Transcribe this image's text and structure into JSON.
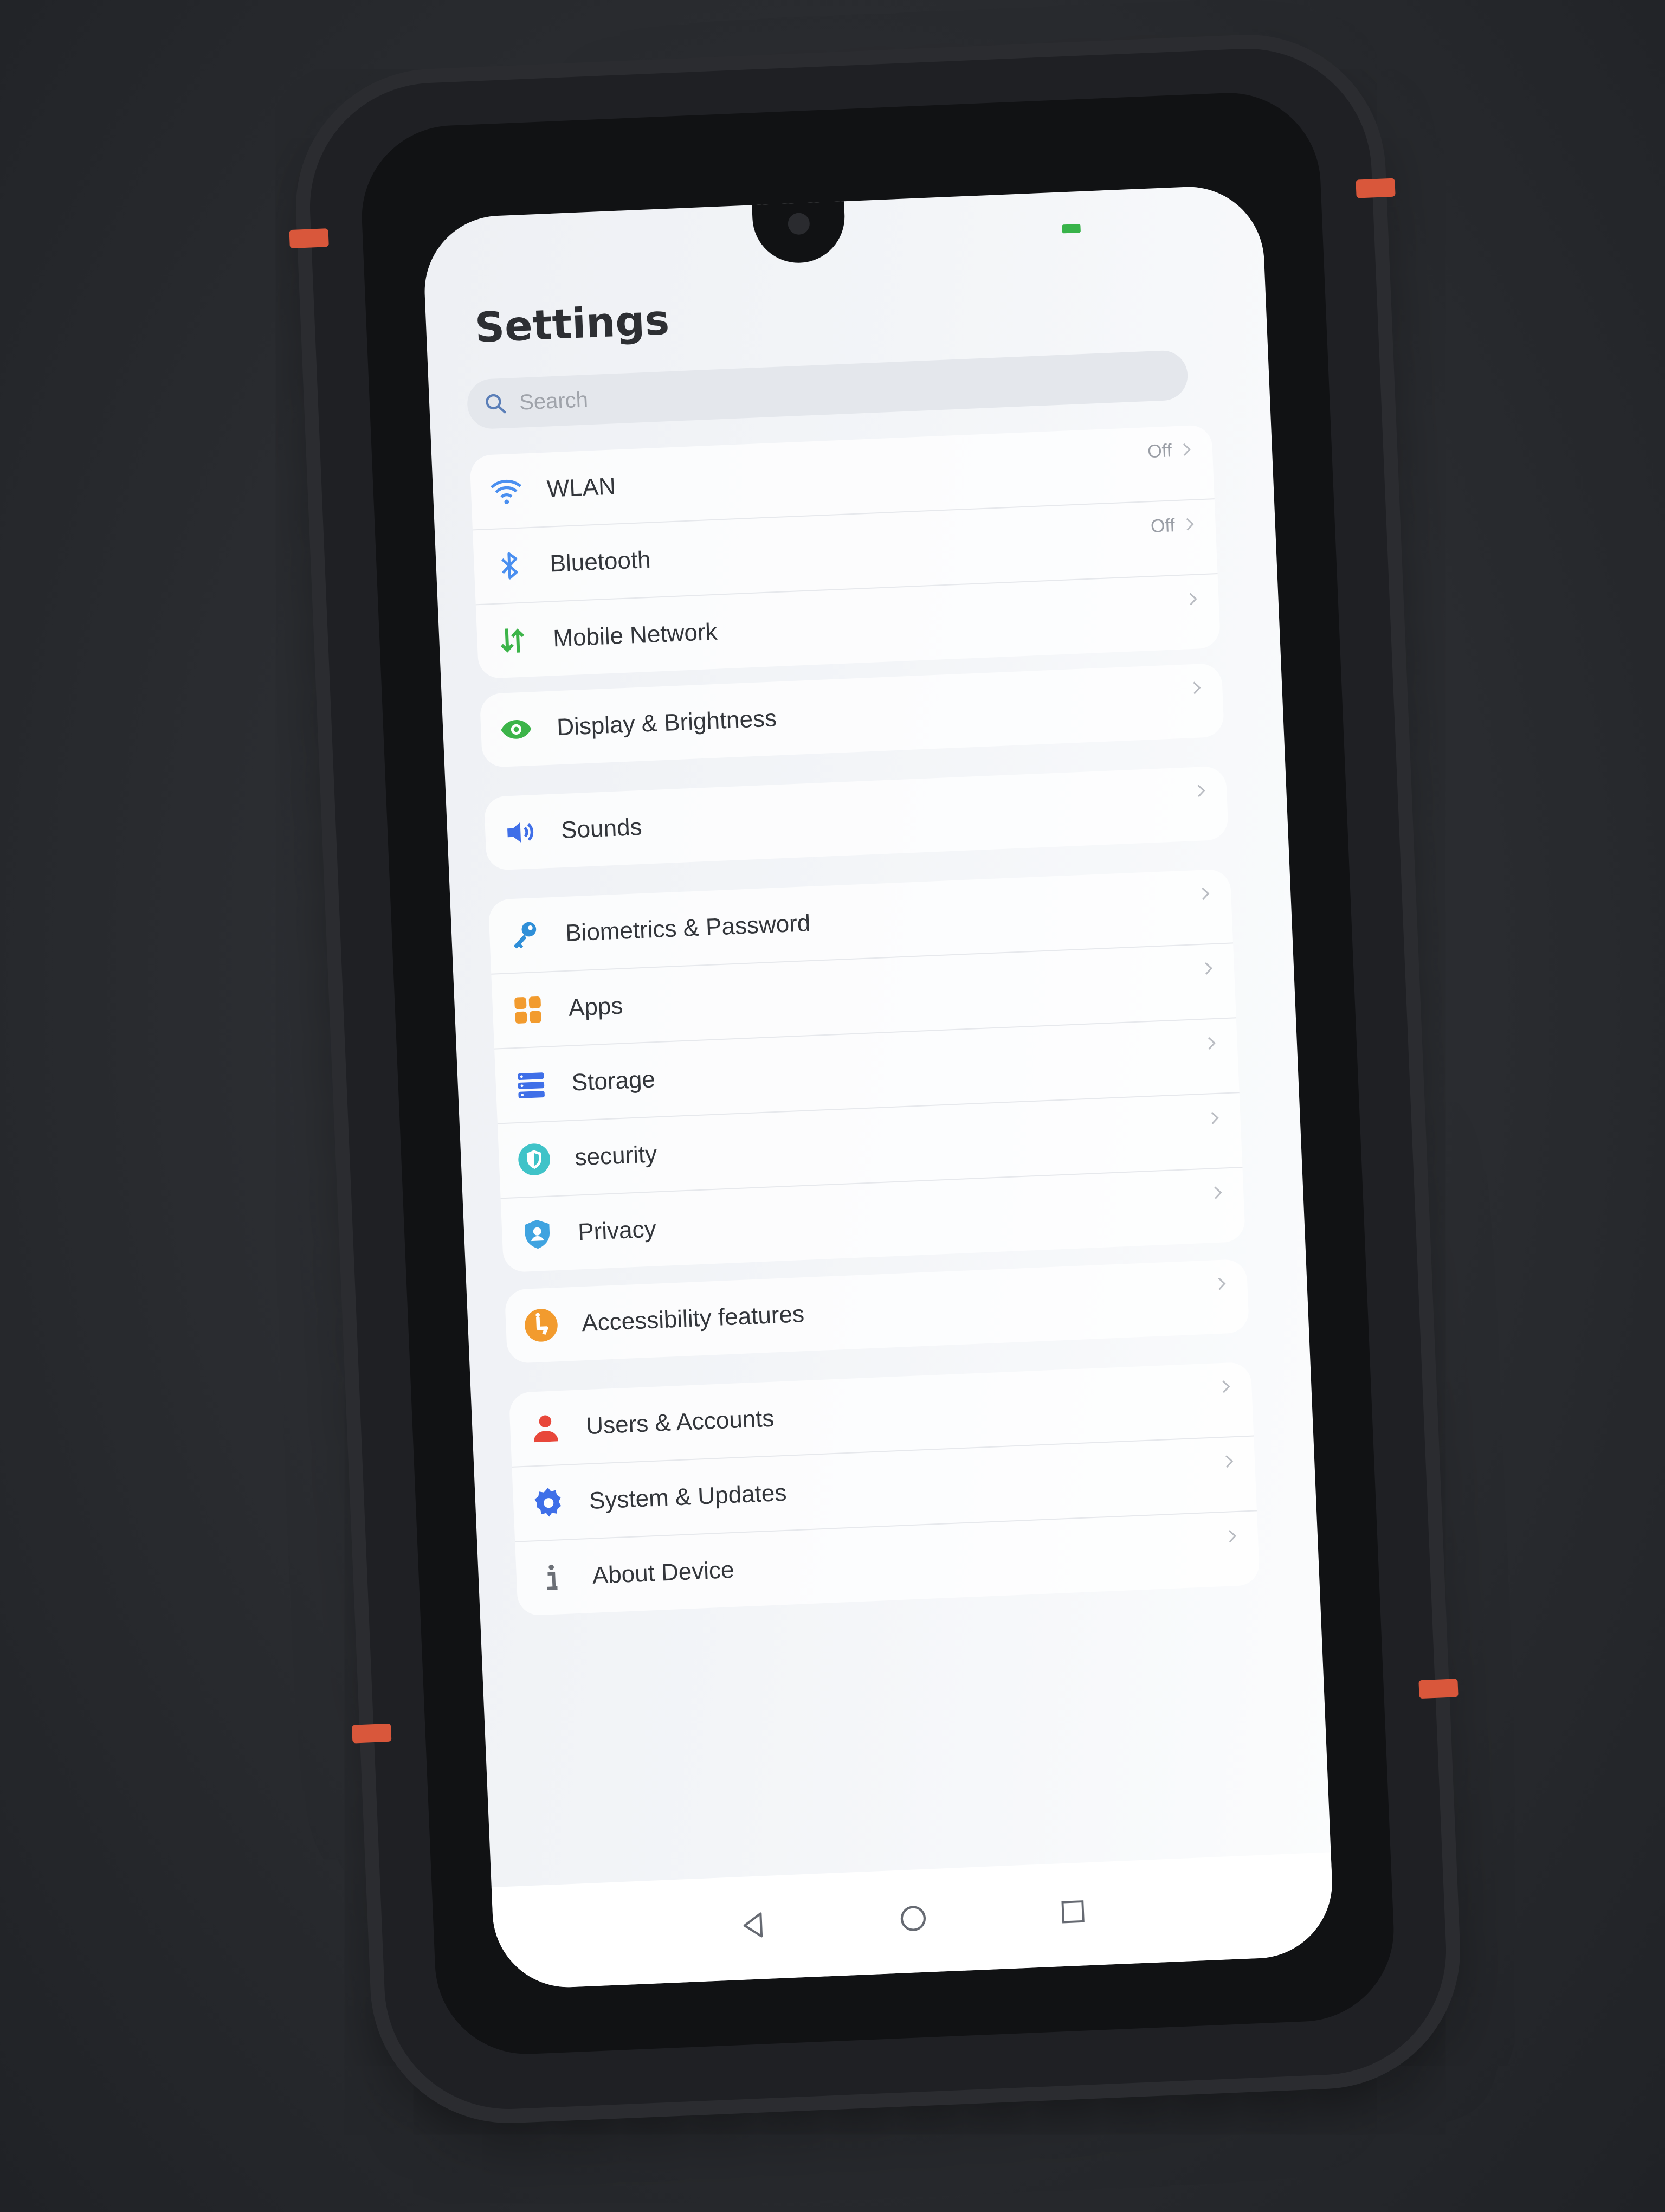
{
  "screen": {
    "title": "Settings",
    "search": {
      "placeholder": "Search"
    }
  },
  "groups": [
    {
      "items": [
        {
          "label": "WLAN",
          "value": "Off",
          "icon": "wifi-icon",
          "color": "#4a8ff0"
        },
        {
          "label": "Bluetooth",
          "value": "Off",
          "icon": "bluetooth-icon",
          "color": "#4a8ff0"
        },
        {
          "label": "Mobile Network",
          "value": "",
          "icon": "mobile-data-icon",
          "color": "#3cb449"
        }
      ]
    },
    {
      "items": [
        {
          "label": "Display & Brightness",
          "value": "",
          "icon": "eye-icon",
          "color": "#3cb449"
        }
      ]
    },
    {
      "items": [
        {
          "label": "Sounds",
          "value": "",
          "icon": "speaker-icon",
          "color": "#3f6fe8"
        }
      ]
    },
    {
      "items": [
        {
          "label": "Biometrics & Password",
          "value": "",
          "icon": "key-icon",
          "color": "#2f8fd8"
        },
        {
          "label": "Apps",
          "value": "",
          "icon": "apps-grid-icon",
          "color": "#f29b2e"
        },
        {
          "label": "Storage",
          "value": "",
          "icon": "storage-icon",
          "color": "#3f6fe8"
        },
        {
          "label": "security",
          "value": "",
          "icon": "shield-icon",
          "color": "#3fc3c8"
        },
        {
          "label": "Privacy",
          "value": "",
          "icon": "privacy-shield-icon",
          "color": "#3fa3e0"
        }
      ]
    },
    {
      "items": [
        {
          "label": "Accessibility features",
          "value": "",
          "icon": "accessibility-icon",
          "color": "#f29b2e"
        }
      ]
    },
    {
      "items": [
        {
          "label": "Users & Accounts",
          "value": "",
          "icon": "user-icon",
          "color": "#e8473a"
        },
        {
          "label": "System & Updates",
          "value": "",
          "icon": "gear-icon",
          "color": "#3f6fe8"
        },
        {
          "label": "About Device",
          "value": "",
          "icon": "info-icon",
          "color": "#6b6f76"
        }
      ]
    }
  ],
  "navigation": {
    "back": "back-triangle-icon",
    "home": "home-circle-icon",
    "recents": "recents-square-icon"
  }
}
